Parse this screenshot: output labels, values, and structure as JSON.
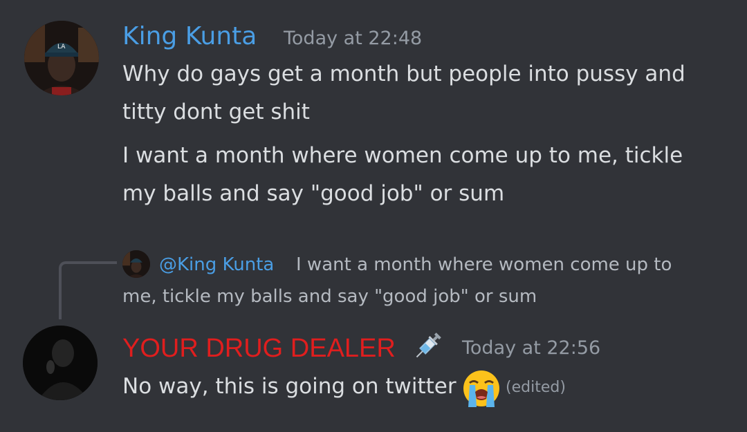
{
  "messages": [
    {
      "username": "King Kunta",
      "timestamp": "Today at 22:48",
      "lines": [
        "Why do gays get a month but people into pussy and",
        "titty dont get shit"
      ]
    },
    {
      "lines": [
        "I want a month where women come up to me, tickle",
        "my balls and say \"good job\" or sum"
      ]
    }
  ],
  "reply": {
    "mention": "@King Kunta",
    "line1": "I want a month where women come up to",
    "line2": "me, tickle my balls and say \"good job\" or sum"
  },
  "reply_message": {
    "username": "YOUR DRUG DEALER",
    "username_icon": "syringe-icon",
    "timestamp": "Today at 22:56",
    "text": "No way, this is going on twitter",
    "emoji": "loudly-crying-face-icon",
    "edited": "(edited)"
  },
  "colors": {
    "background": "#313338",
    "king_kunta_name": "#4a9ee5",
    "drug_dealer_name": "#e01e1e",
    "timestamp": "#949ba4",
    "message_text": "#dbdee1"
  }
}
